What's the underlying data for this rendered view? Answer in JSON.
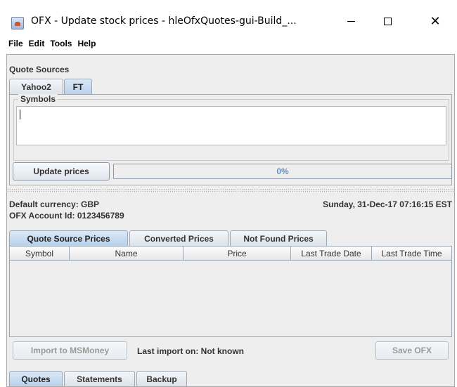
{
  "window": {
    "title": "OFX - Update stock prices - hleOfxQuotes-gui-Build_...",
    "minimize": "minimize",
    "maximize": "maximize",
    "close": "✕"
  },
  "menu": [
    "File",
    "Edit",
    "Tools",
    "Help"
  ],
  "quote_sources": {
    "label": "Quote Sources",
    "tabs": [
      {
        "label": "Yahoo2",
        "selected": false
      },
      {
        "label": "FT",
        "selected": true
      }
    ],
    "symbols_label": "Symbols",
    "symbols_value": "",
    "update_button": "Update prices",
    "progress": {
      "value": 0,
      "text": "0%"
    }
  },
  "info": {
    "currency": "Default currency: GBP",
    "account": "OFX Account Id: 0123456789",
    "datetime": "Sunday, 31-Dec-17 07:16:15 EST"
  },
  "price_tabs": [
    {
      "label": "Quote Source Prices",
      "selected": true
    },
    {
      "label": "Converted Prices",
      "selected": false
    },
    {
      "label": "Not Found Prices",
      "selected": false
    }
  ],
  "table": {
    "columns": [
      "Symbol",
      "Name",
      "Price",
      "Last Trade Date",
      "Last Trade Time"
    ],
    "rows": []
  },
  "actions": {
    "import_button": "Import to MSMoney",
    "last_import": "Last import on: Not known",
    "save_button": "Save OFX"
  },
  "bottom_tabs": [
    {
      "label": "Quotes",
      "selected": true
    },
    {
      "label": "Statements",
      "selected": false
    },
    {
      "label": "Backup",
      "selected": false
    }
  ]
}
